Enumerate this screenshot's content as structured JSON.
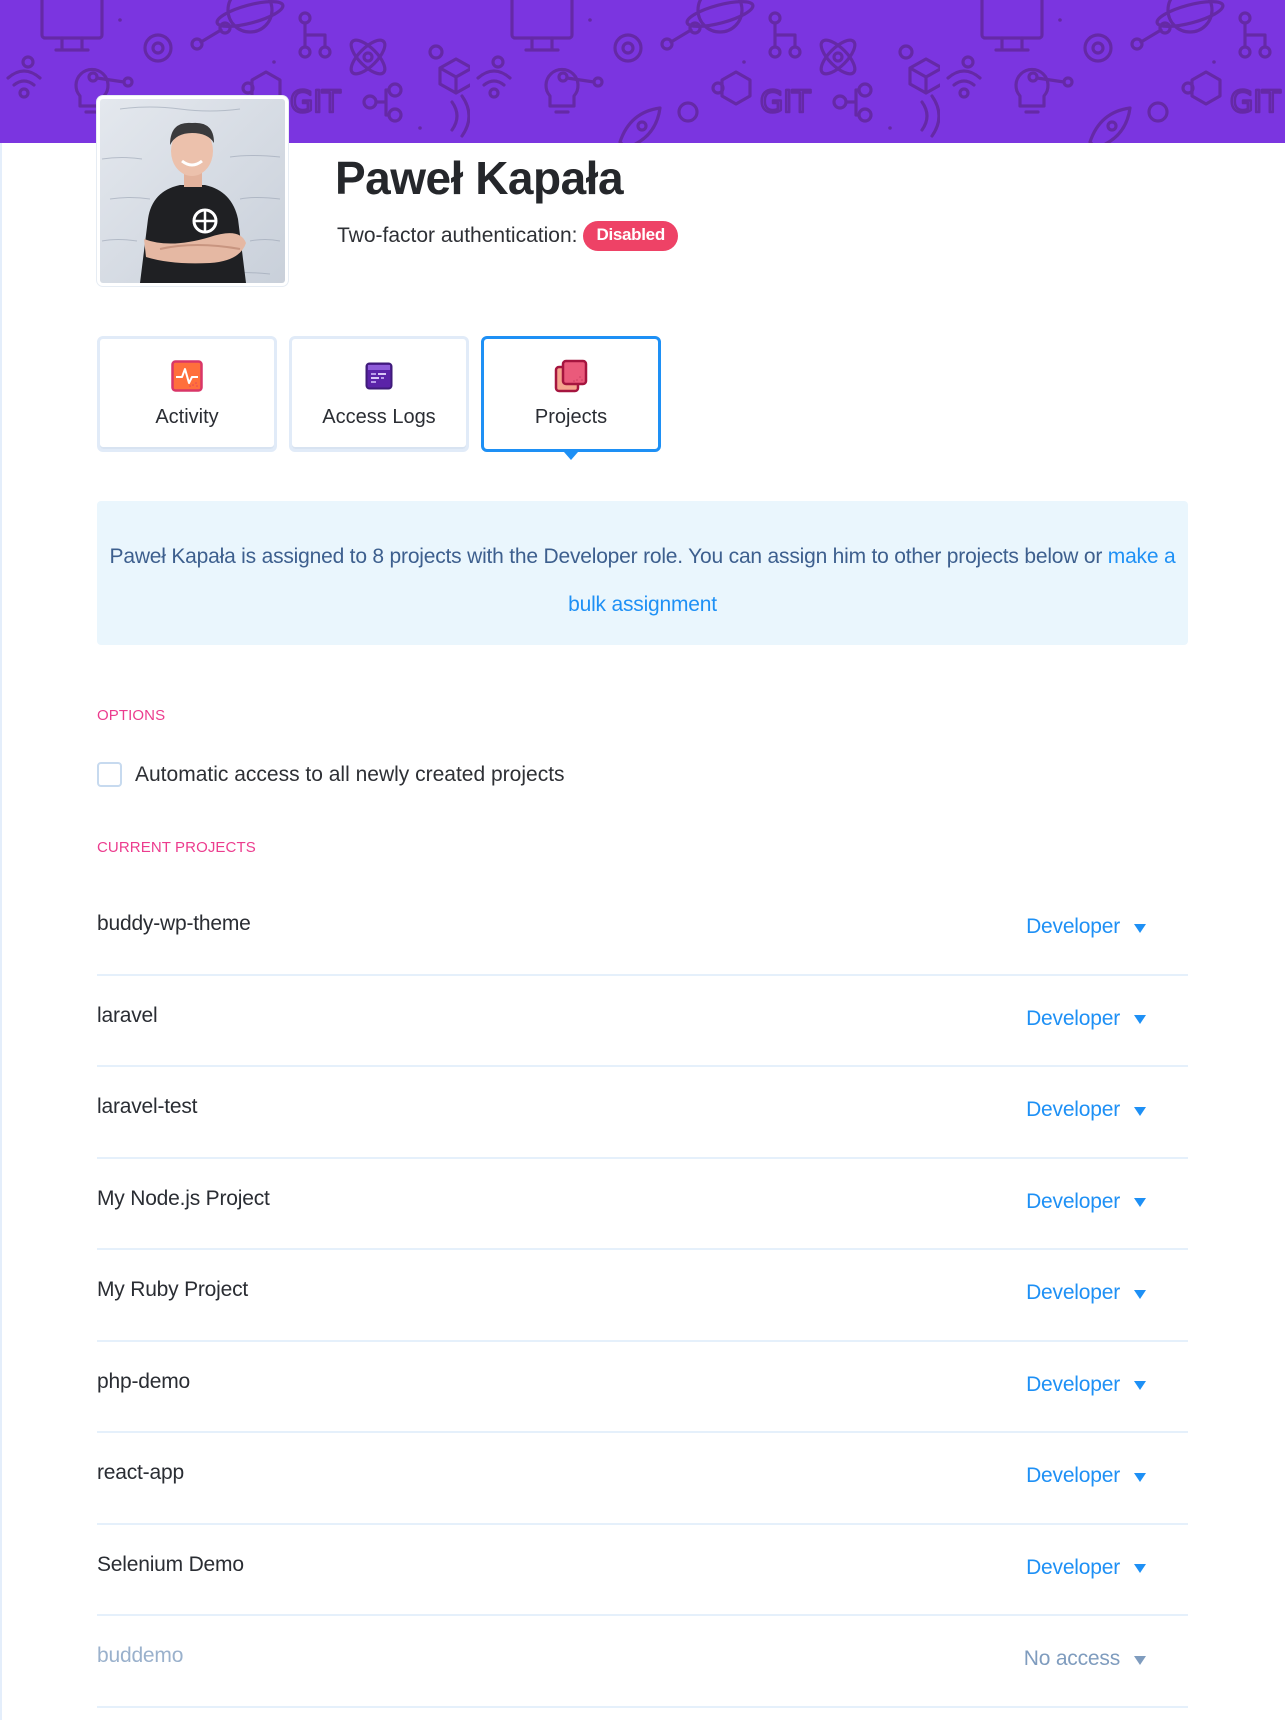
{
  "colors": {
    "banner": "#7b35e0",
    "accent": "#1e90f5",
    "section_label": "#ec3c8e",
    "badge_disabled": "#ee4266",
    "info_bg": "#eaf6fd"
  },
  "user": {
    "name": "Paweł Kapała",
    "twofa_label": "Two-factor authentication:",
    "twofa_status": "Disabled"
  },
  "tabs": [
    {
      "label": "Activity",
      "icon": "activity-icon",
      "active": false
    },
    {
      "label": "Access Logs",
      "icon": "access-logs-icon",
      "active": false
    },
    {
      "label": "Projects",
      "icon": "projects-icon",
      "active": true
    }
  ],
  "info": {
    "text": "Paweł Kapała is assigned to 8 projects with the Developer role. You can assign him to other projects below or ",
    "link": "make a bulk assignment"
  },
  "options": {
    "heading": "OPTIONS",
    "auto_access_label": "Automatic access to all newly created projects",
    "auto_access_checked": false
  },
  "current_projects": {
    "heading": "CURRENT PROJECTS",
    "items": [
      {
        "name": "buddy-wp-theme",
        "role": "Developer",
        "has_access": true
      },
      {
        "name": "laravel",
        "role": "Developer",
        "has_access": true
      },
      {
        "name": "laravel-test",
        "role": "Developer",
        "has_access": true
      },
      {
        "name": "My Node.js Project",
        "role": "Developer",
        "has_access": true
      },
      {
        "name": "My Ruby Project",
        "role": "Developer",
        "has_access": true
      },
      {
        "name": "php-demo",
        "role": "Developer",
        "has_access": true
      },
      {
        "name": "react-app",
        "role": "Developer",
        "has_access": true
      },
      {
        "name": "Selenium Demo",
        "role": "Developer",
        "has_access": true
      },
      {
        "name": "buddemo",
        "role": "No access",
        "has_access": false
      }
    ]
  }
}
